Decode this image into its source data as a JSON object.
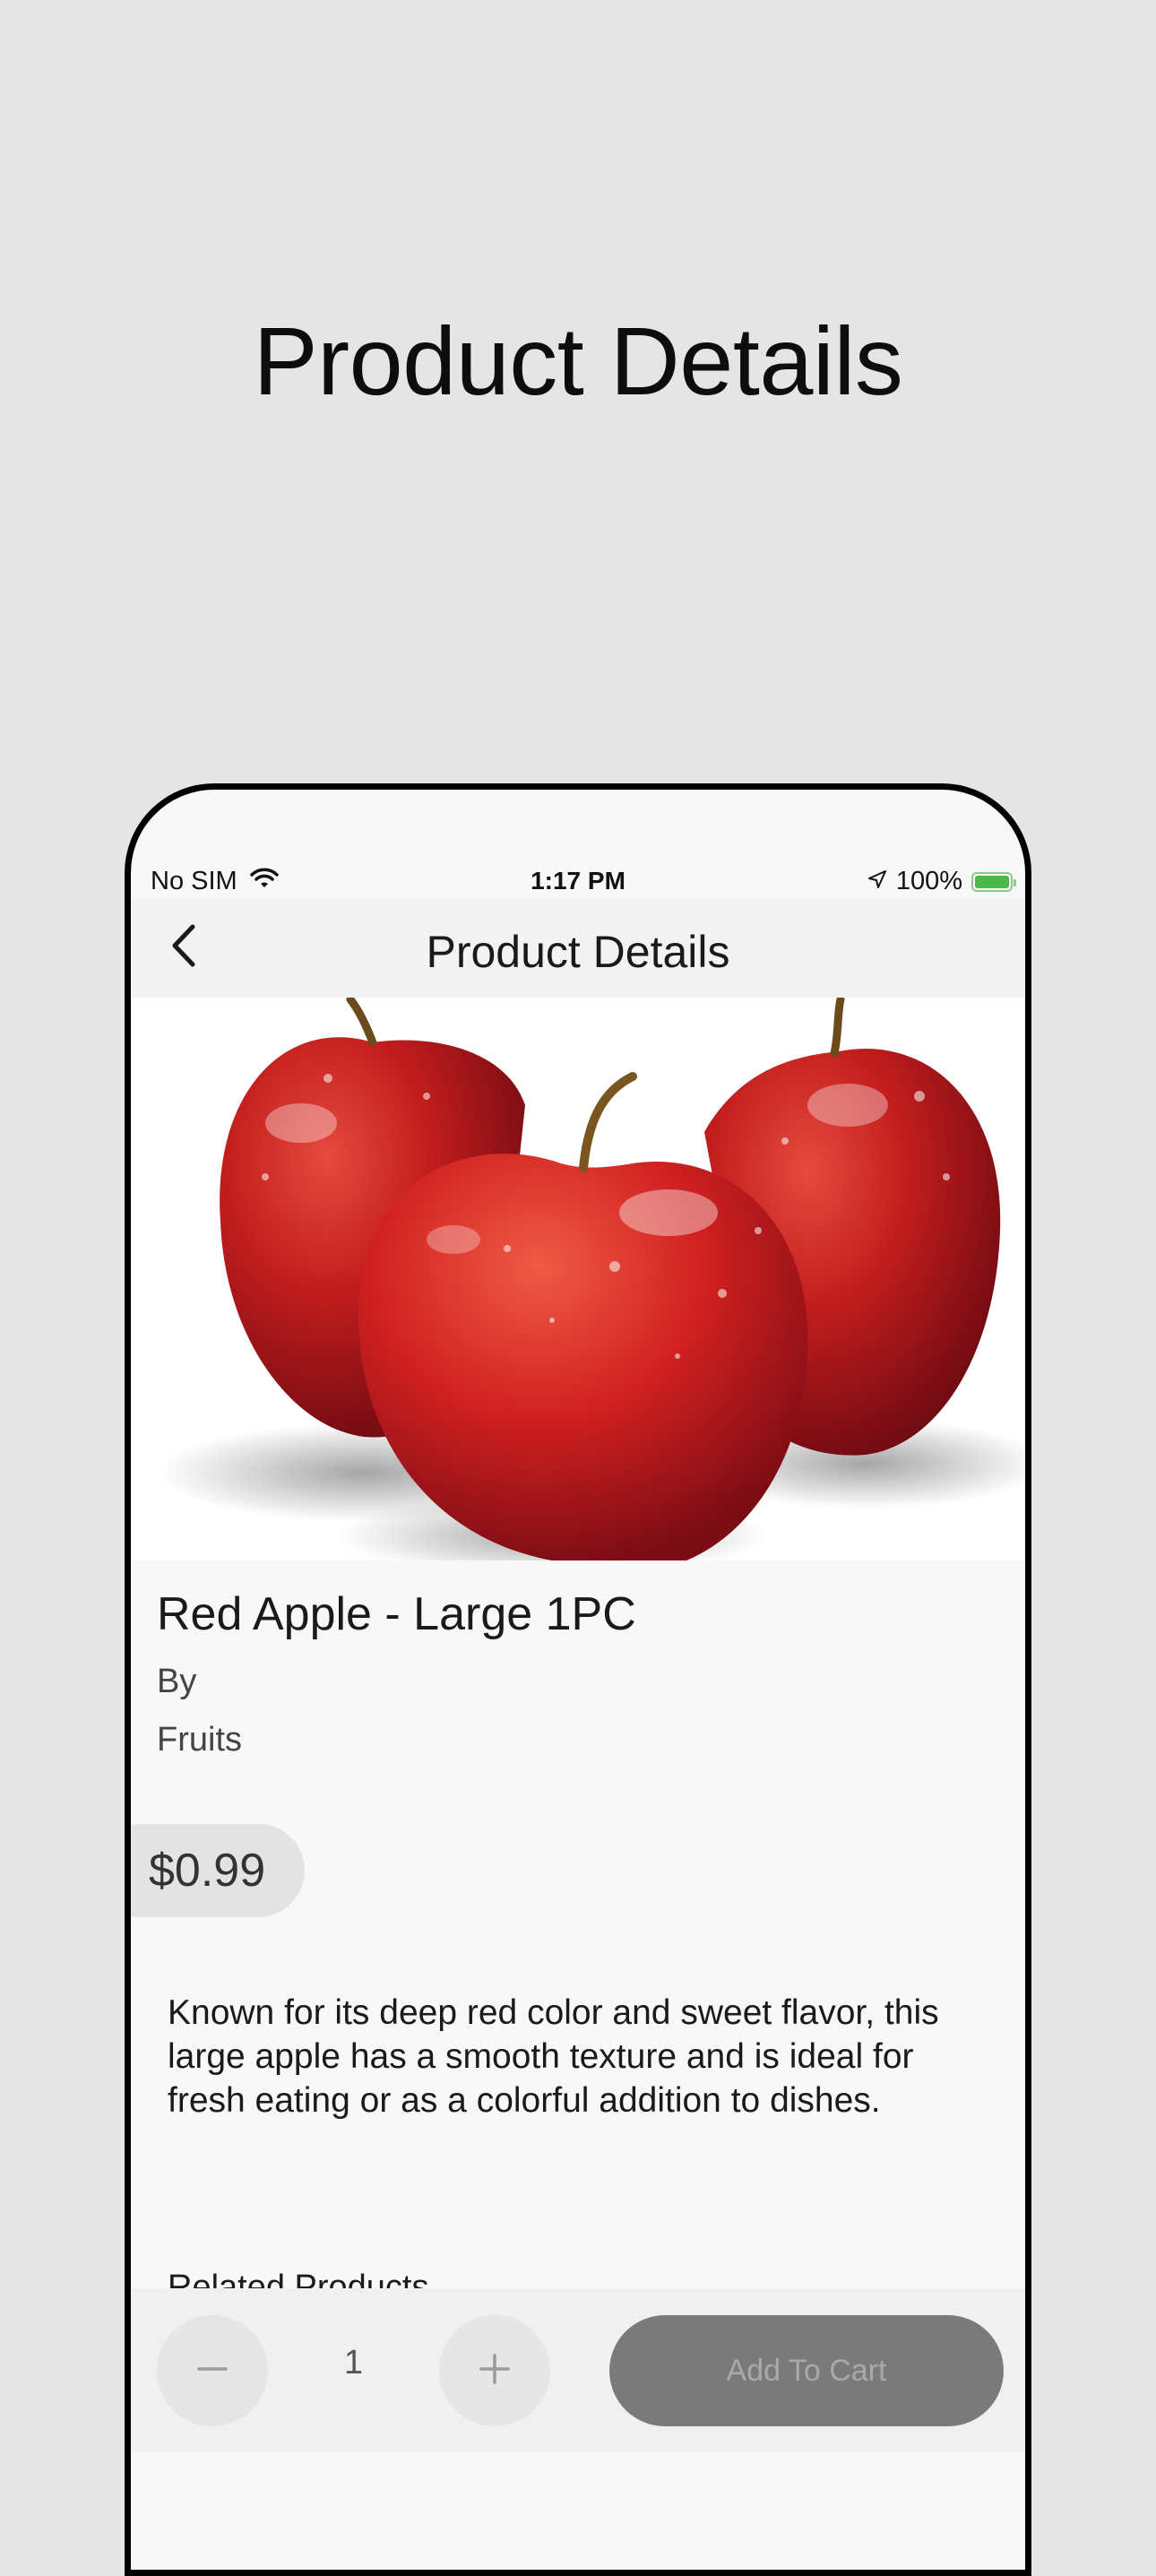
{
  "hero": {
    "title": "Product Details"
  },
  "status_bar": {
    "carrier": "No SIM",
    "time": "1:17 PM",
    "battery_percent": "100%",
    "icons": [
      "wifi-icon",
      "location-arrow-icon",
      "battery-charging-icon"
    ]
  },
  "nav": {
    "title": "Product Details",
    "back_icon": "chevron-left-icon"
  },
  "product": {
    "image_alt": "Three red apples",
    "name": "Red Apple - Large 1PC",
    "by": "By",
    "category": "Fruits",
    "price": "$0.99",
    "description": "Known for its deep red color and sweet flavor, this large apple has a smooth texture and is ideal for fresh eating or as a colorful addition to dishes.",
    "related_label": "Related Products"
  },
  "cart": {
    "quantity": "1",
    "minus_icon": "minus-icon",
    "plus_icon": "plus-icon",
    "add_label": "Add To Cart"
  },
  "colors": {
    "page_background": "#e5e5e5",
    "screen_background": "#f8f8f8",
    "add_cart_button": "#7a7a7a",
    "battery_fill": "#4cb84a"
  }
}
